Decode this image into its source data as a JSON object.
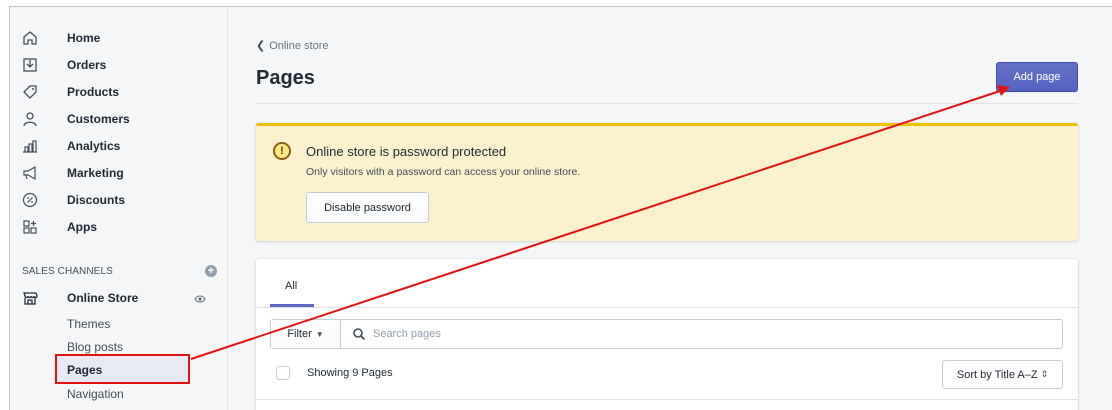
{
  "sidebar": {
    "items": [
      {
        "label": "Home",
        "icon": "home-icon"
      },
      {
        "label": "Orders",
        "icon": "orders-icon"
      },
      {
        "label": "Products",
        "icon": "tag-icon"
      },
      {
        "label": "Customers",
        "icon": "user-icon"
      },
      {
        "label": "Analytics",
        "icon": "bar-chart-icon"
      },
      {
        "label": "Marketing",
        "icon": "megaphone-icon"
      },
      {
        "label": "Discounts",
        "icon": "discount-icon"
      },
      {
        "label": "Apps",
        "icon": "apps-icon"
      }
    ],
    "sales_channels": {
      "label": "SALES CHANNELS",
      "add_icon": "plus-circle-icon",
      "store": {
        "label": "Online Store",
        "icon": "store-icon",
        "view_icon": "eye-icon",
        "subitems": [
          {
            "label": "Themes",
            "active": false
          },
          {
            "label": "Blog posts",
            "active": false
          },
          {
            "label": "Pages",
            "active": true
          },
          {
            "label": "Navigation",
            "active": false
          }
        ]
      }
    }
  },
  "header": {
    "breadcrumb": "Online store",
    "title": "Pages",
    "primary_action": "Add page"
  },
  "banner": {
    "title": "Online store is password protected",
    "text": "Only visitors with a password can access your online store.",
    "button": "Disable password",
    "icon": "warning-icon"
  },
  "list": {
    "tabs": [
      {
        "label": "All",
        "selected": true
      }
    ],
    "filter_label": "Filter",
    "search_placeholder": "Search pages",
    "showing_text": "Showing 9 Pages",
    "sort_label": "Sort by Title A–Z"
  },
  "colors": {
    "accent": "#5c6ac4",
    "banner_bg": "#fcf1cd",
    "banner_border": "#eec200",
    "annotation": "#e31212"
  }
}
